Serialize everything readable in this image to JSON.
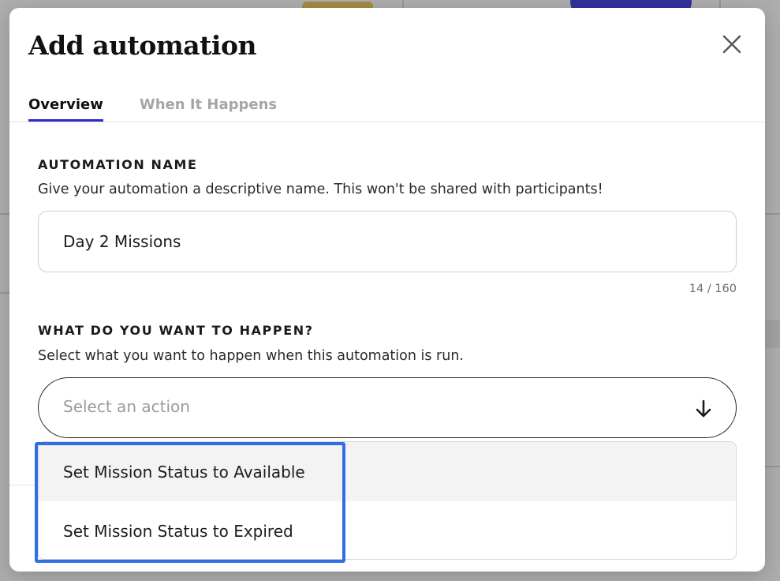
{
  "modal": {
    "title": "Add automation",
    "close_icon": "close-icon",
    "tabs": [
      {
        "label": "Overview",
        "active": true
      },
      {
        "label": "When It Happens",
        "active": false
      }
    ],
    "automation_name": {
      "label": "AUTOMATION NAME",
      "help": "Give your automation a descriptive name. This won't be shared with participants!",
      "value": "Day 2 Missions",
      "char_count": "14 / 160"
    },
    "action": {
      "label": "WHAT DO YOU WANT TO HAPPEN?",
      "help": "Select what you want to happen when this automation is run.",
      "placeholder": "Select an action",
      "arrow_icon": "arrow-down-icon",
      "options": [
        {
          "label": "Set Mission Status to Available"
        },
        {
          "label": "Set Mission Status to Expired"
        }
      ]
    }
  },
  "colors": {
    "accent": "#2b2bd4",
    "highlight": "#2f6fe4",
    "overlay": "#3c3c3c"
  }
}
